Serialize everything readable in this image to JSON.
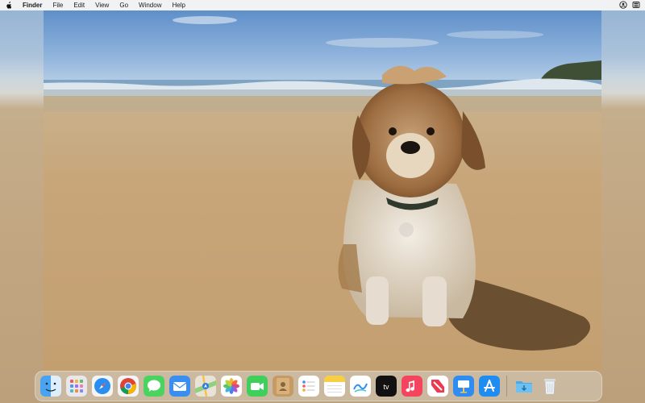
{
  "menubar": {
    "app_name": "Finder",
    "items": [
      "File",
      "Edit",
      "View",
      "Go",
      "Window",
      "Help"
    ]
  },
  "desktop": {
    "wallpaper": "beach-dog-photo"
  },
  "dock": {
    "apps": [
      {
        "name": "Finder",
        "icon": "finder-icon"
      },
      {
        "name": "Launchpad",
        "icon": "launchpad-icon"
      },
      {
        "name": "Safari",
        "icon": "safari-icon"
      },
      {
        "name": "Chrome",
        "icon": "chrome-icon"
      },
      {
        "name": "Messages",
        "icon": "messages-icon"
      },
      {
        "name": "Mail",
        "icon": "mail-icon"
      },
      {
        "name": "Maps",
        "icon": "maps-icon"
      },
      {
        "name": "Photos",
        "icon": "photos-icon"
      },
      {
        "name": "FaceTime",
        "icon": "facetime-icon"
      },
      {
        "name": "Contacts",
        "icon": "contacts-icon"
      },
      {
        "name": "Reminders",
        "icon": "reminders-icon"
      },
      {
        "name": "Notes",
        "icon": "notes-icon"
      },
      {
        "name": "Freeform",
        "icon": "freeform-icon"
      },
      {
        "name": "TV",
        "icon": "tv-icon"
      },
      {
        "name": "Music",
        "icon": "music-icon"
      },
      {
        "name": "News",
        "icon": "news-icon"
      },
      {
        "name": "Keynote",
        "icon": "keynote-icon"
      },
      {
        "name": "App Store",
        "icon": "app-store-icon"
      },
      {
        "name": "Downloads",
        "icon": "downloads-folder-icon"
      },
      {
        "name": "Trash",
        "icon": "trash-icon"
      }
    ],
    "tv_label": "tv"
  }
}
